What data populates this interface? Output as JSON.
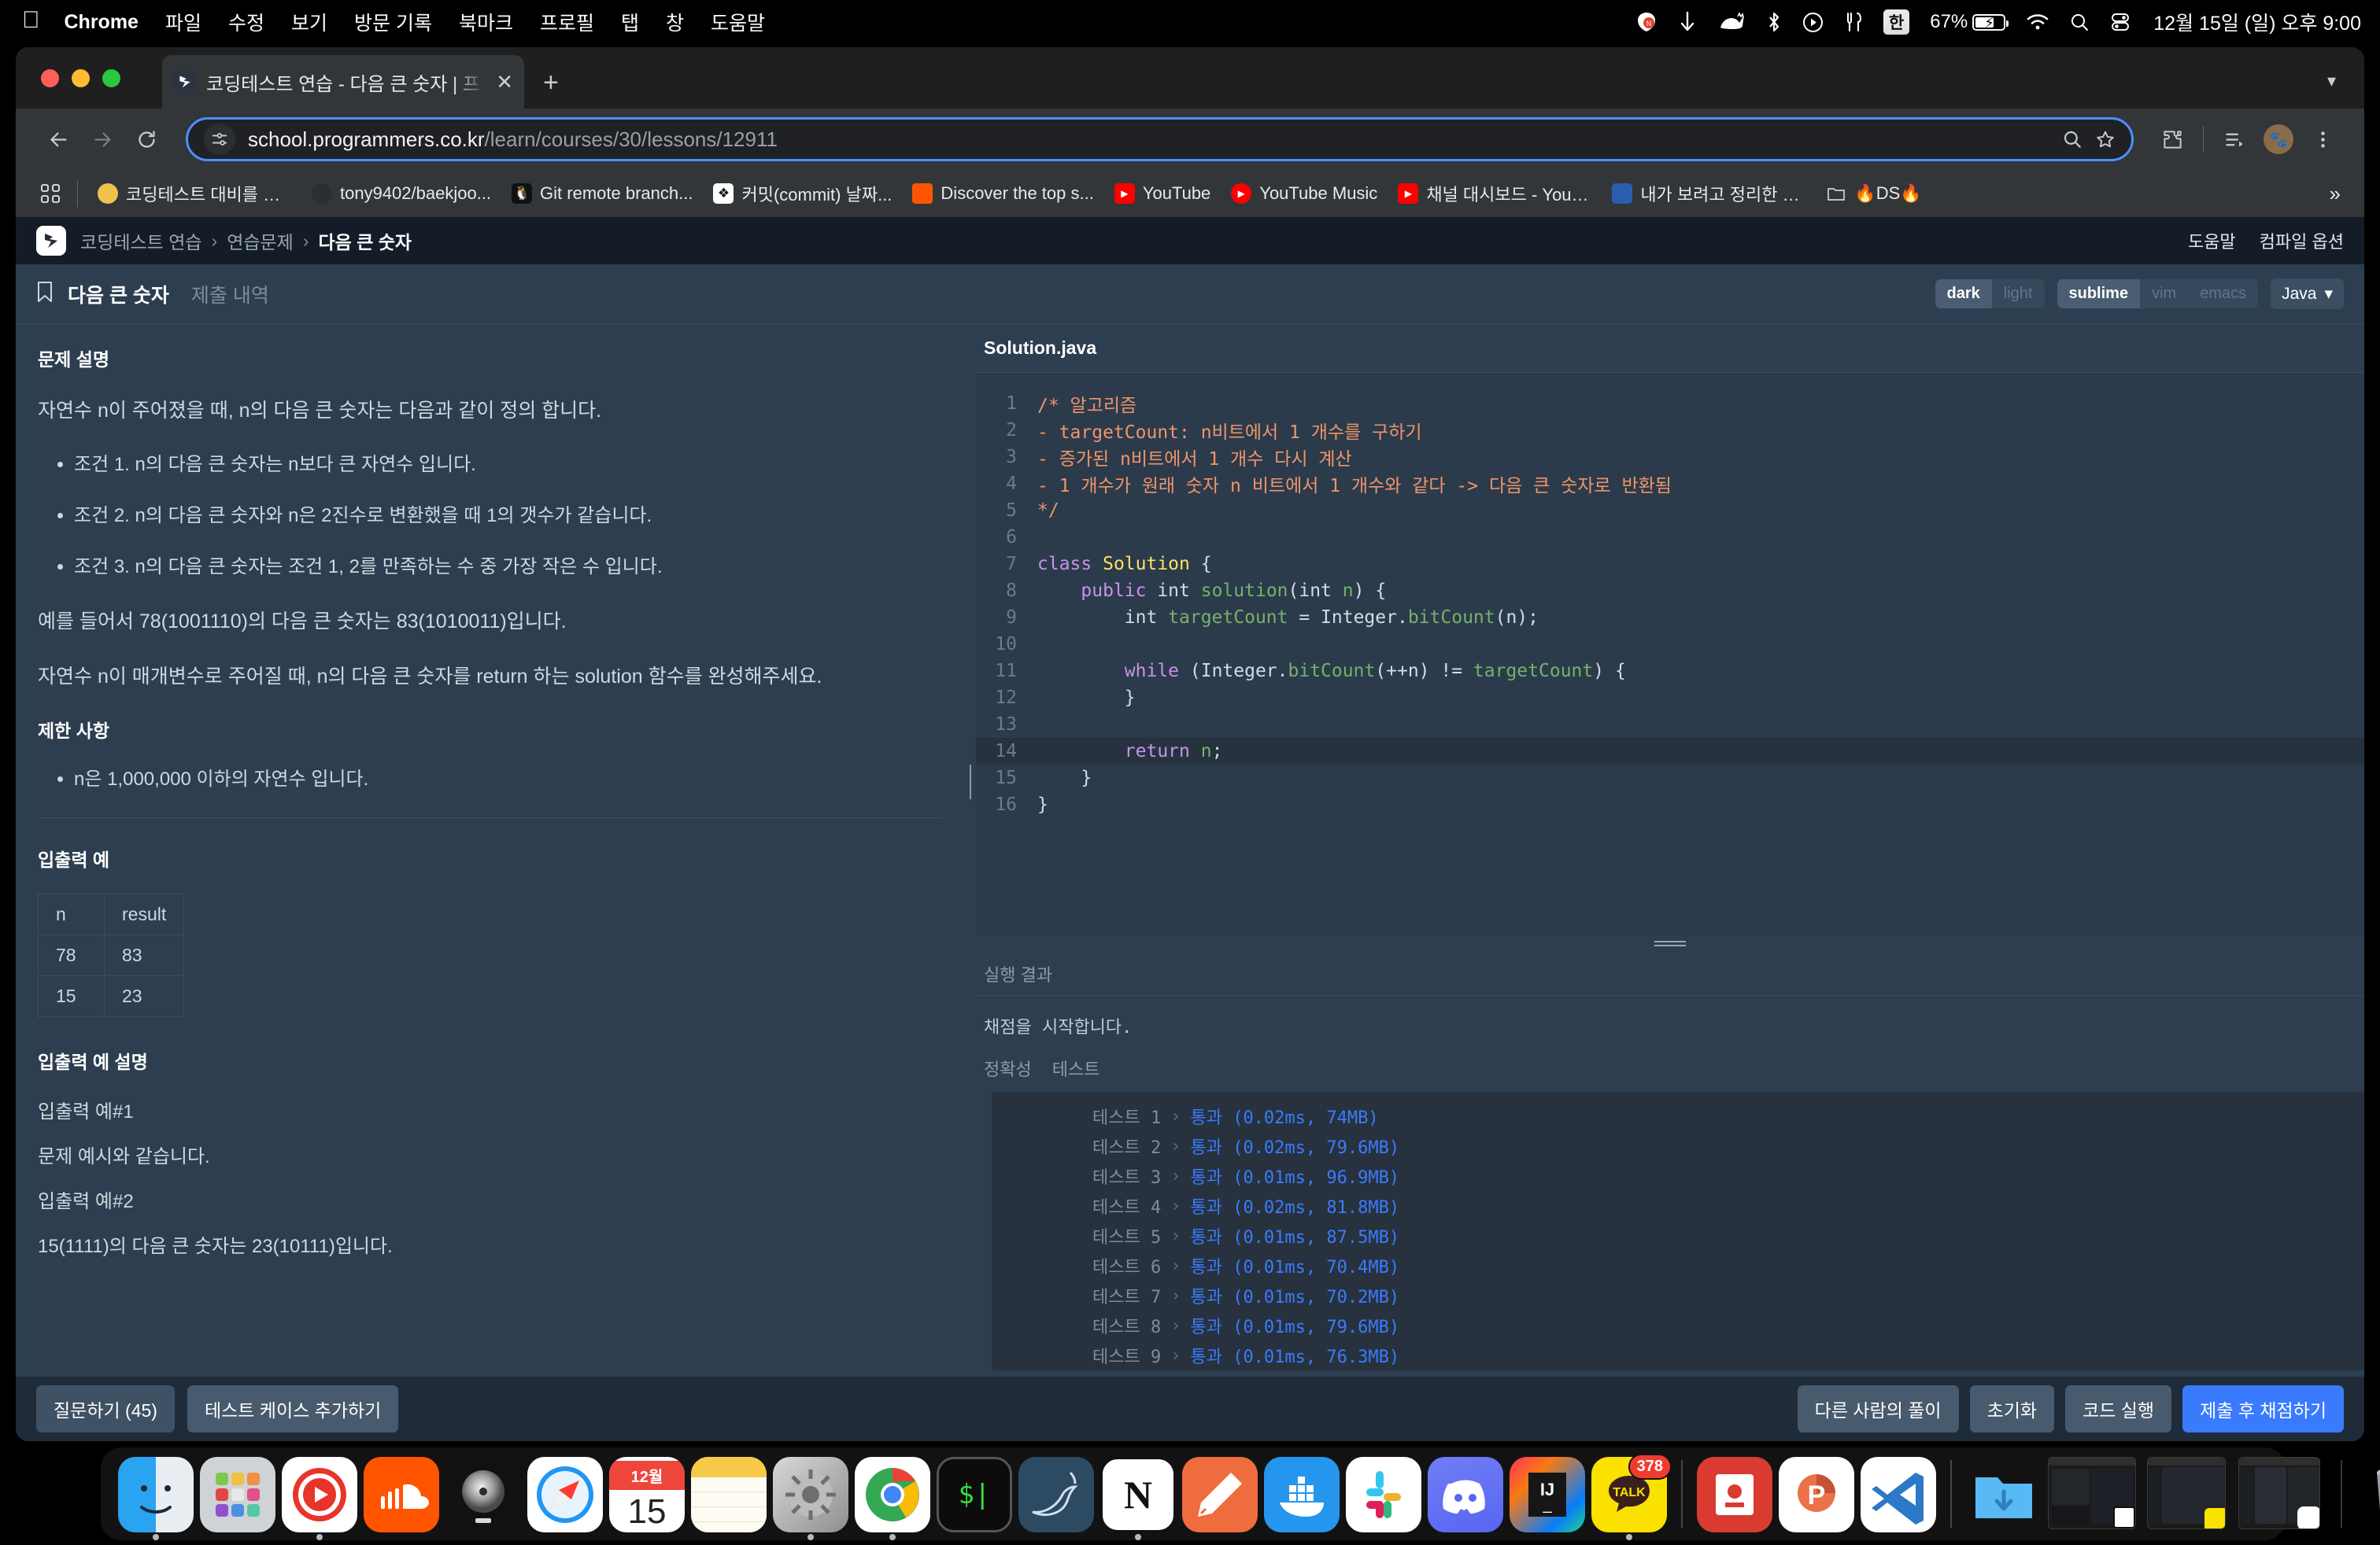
{
  "menubar": {
    "apple": "apple-logo",
    "app": "Chrome",
    "items": [
      "파일",
      "수정",
      "보기",
      "방문 기록",
      "북마크",
      "프로필",
      "탭",
      "창",
      "도움말"
    ],
    "status": {
      "battery_percent": "67%",
      "ime": "한",
      "clock": "12월 15일 (일) 오후 9:00",
      "icons": [
        "notion-icon",
        "download-arrow-icon",
        "cat-icon",
        "bluetooth-icon",
        "play-circle-icon",
        "utensils-icon",
        "ime-badge",
        "battery-icon",
        "wifi-icon",
        "spotlight-search-icon",
        "control-center-icon"
      ]
    }
  },
  "browser": {
    "tab": {
      "title": "코딩테스트 연습 - 다음 큰 숫자 | 프",
      "favicon": "programmers-icon",
      "close": "✕"
    },
    "newtab_label": "+",
    "url_host": "school.programmers.co.kr",
    "url_path": "/learn/courses/30/lessons/12911",
    "bookmarks": [
      {
        "label": "코딩테스트 대비를 위...",
        "icon": "coin-icon"
      },
      {
        "label": "tony9402/baekjoo...",
        "icon": "github-icon"
      },
      {
        "label": "Git remote branch...",
        "icon": "penguin-icon"
      },
      {
        "label": "커밋(commit) 날짜...",
        "icon": "git-icon"
      },
      {
        "label": "Discover the top s...",
        "icon": "soundcloud-icon"
      },
      {
        "label": "YouTube",
        "icon": "youtube-icon"
      },
      {
        "label": "YouTube Music",
        "icon": "youtube-music-icon"
      },
      {
        "label": "채널 대시보드 - YouT...",
        "icon": "youtube-studio-icon"
      },
      {
        "label": "내가 보려고 정리한 정...",
        "icon": "notion-blue-icon"
      },
      {
        "label": "🔥DS🔥",
        "icon": "folder-icon"
      }
    ],
    "overflow": "»"
  },
  "site": {
    "breadcrumb": [
      "코딩테스트 연습",
      "연습문제",
      "다음 큰 숫자"
    ],
    "header_links": [
      "도움말",
      "컴파일 옵션"
    ],
    "tabs": [
      {
        "label": "다음 큰 숫자",
        "active": true
      },
      {
        "label": "제출 내역",
        "active": false
      }
    ],
    "options": {
      "theme": [
        {
          "label": "dark",
          "on": true
        },
        {
          "label": "light",
          "on": false
        }
      ],
      "keymap": [
        {
          "label": "sublime",
          "on": true
        },
        {
          "label": "vim",
          "on": false
        },
        {
          "label": "emacs",
          "on": false
        }
      ],
      "language": "Java"
    }
  },
  "problem": {
    "desc_title": "문제 설명",
    "intro": "자연수 n이 주어졌을 때, n의 다음 큰 숫자는 다음과 같이 정의 합니다.",
    "conditions": [
      "조건 1. n의 다음 큰 숫자는 n보다 큰 자연수 입니다.",
      "조건 2. n의 다음 큰 숫자와 n은 2진수로 변환했을 때 1의 갯수가 같습니다.",
      "조건 3. n의 다음 큰 숫자는 조건 1, 2를 만족하는 수 중 가장 작은 수 입니다."
    ],
    "example_sentence": "예를 들어서 78(1001110)의 다음 큰 숫자는 83(1010011)입니다.",
    "task_sentence": "자연수 n이 매개변수로 주어질 때, n의 다음 큰 숫자를 return 하는 solution 함수를 완성해주세요.",
    "limits_title": "제한 사항",
    "limits": [
      "n은 1,000,000 이하의 자연수 입니다."
    ],
    "io_title": "입출력 예",
    "io_table": {
      "headers": [
        "n",
        "result"
      ],
      "rows": [
        [
          "78",
          "83"
        ],
        [
          "15",
          "23"
        ]
      ]
    },
    "io_expl_title": "입출력 예 설명",
    "io_expl": [
      "입출력 예#1",
      "문제 예시와 같습니다.",
      "입출력 예#2",
      "15(1111)의 다음 큰 숫자는 23(10111)입니다."
    ]
  },
  "editor": {
    "filename": "Solution.java",
    "highlight_line": 14,
    "lines": [
      {
        "n": "1",
        "tokens": [
          {
            "t": "/* 알고리즘",
            "c": "c-com"
          }
        ]
      },
      {
        "n": "2",
        "tokens": [
          {
            "t": "- targetCount: n비트에서 1 개수를 구하기",
            "c": "c-com"
          }
        ]
      },
      {
        "n": "3",
        "tokens": [
          {
            "t": "- 증가된 n비트에서 1 개수 다시 계산",
            "c": "c-com"
          }
        ]
      },
      {
        "n": "4",
        "tokens": [
          {
            "t": "- 1 개수가 원래 숫자 n 비트에서 1 개수와 같다 -> 다음 큰 숫자로 반환됨",
            "c": "c-com"
          }
        ]
      },
      {
        "n": "5",
        "tokens": [
          {
            "t": "*/",
            "c": "c-com"
          }
        ]
      },
      {
        "n": "6",
        "tokens": [
          {
            "t": "",
            "c": "ctext"
          }
        ]
      },
      {
        "n": "7",
        "tokens": [
          {
            "t": "class ",
            "c": "c-kw"
          },
          {
            "t": "Solution",
            "c": "c-cls"
          },
          {
            "t": " {",
            "c": "c-pun"
          }
        ]
      },
      {
        "n": "8",
        "tokens": [
          {
            "t": "    ",
            "c": "ctext"
          },
          {
            "t": "public",
            "c": "c-kw"
          },
          {
            "t": " int ",
            "c": "c-typ"
          },
          {
            "t": "solution",
            "c": "c-fn"
          },
          {
            "t": "(int ",
            "c": "c-pun"
          },
          {
            "t": "n",
            "c": "c-var"
          },
          {
            "t": ") {",
            "c": "c-pun"
          }
        ]
      },
      {
        "n": "9",
        "tokens": [
          {
            "t": "        int ",
            "c": "c-typ"
          },
          {
            "t": "targetCount",
            "c": "c-var"
          },
          {
            "t": " = Integer.",
            "c": "c-pun"
          },
          {
            "t": "bitCount",
            "c": "c-fn"
          },
          {
            "t": "(n);",
            "c": "c-pun"
          }
        ]
      },
      {
        "n": "10",
        "tokens": [
          {
            "t": "",
            "c": "ctext"
          }
        ]
      },
      {
        "n": "11",
        "tokens": [
          {
            "t": "        ",
            "c": "ctext"
          },
          {
            "t": "while",
            "c": "c-kw"
          },
          {
            "t": " (Integer.",
            "c": "c-pun"
          },
          {
            "t": "bitCount",
            "c": "c-fn"
          },
          {
            "t": "(++n) != ",
            "c": "c-pun"
          },
          {
            "t": "targetCount",
            "c": "c-var"
          },
          {
            "t": ") {",
            "c": "c-pun"
          }
        ]
      },
      {
        "n": "12",
        "tokens": [
          {
            "t": "        }",
            "c": "c-pun"
          }
        ]
      },
      {
        "n": "13",
        "tokens": [
          {
            "t": "",
            "c": "ctext"
          }
        ]
      },
      {
        "n": "14",
        "tokens": [
          {
            "t": "        ",
            "c": "ctext"
          },
          {
            "t": "return",
            "c": "c-kw"
          },
          {
            "t": " ",
            "c": "ctext"
          },
          {
            "t": "n",
            "c": "c-var"
          },
          {
            "t": ";",
            "c": "c-pun"
          }
        ]
      },
      {
        "n": "15",
        "tokens": [
          {
            "t": "    }",
            "c": "c-pun"
          }
        ]
      },
      {
        "n": "16",
        "tokens": [
          {
            "t": "}",
            "c": "c-pun"
          }
        ]
      }
    ]
  },
  "result": {
    "title": "실행 결과",
    "status_line": "채점을 시작합니다.",
    "tabs": [
      "정확성",
      "테스트"
    ],
    "tests": [
      {
        "name": "테스트 1",
        "chev": "›",
        "result": "통과 (0.02ms, 74MB)"
      },
      {
        "name": "테스트 2",
        "chev": "›",
        "result": "통과 (0.02ms, 79.6MB)"
      },
      {
        "name": "테스트 3",
        "chev": "›",
        "result": "통과 (0.01ms, 96.9MB)"
      },
      {
        "name": "테스트 4",
        "chev": "›",
        "result": "통과 (0.02ms, 81.8MB)"
      },
      {
        "name": "테스트 5",
        "chev": "›",
        "result": "통과 (0.01ms, 87.5MB)"
      },
      {
        "name": "테스트 6",
        "chev": "›",
        "result": "통과 (0.01ms, 70.4MB)"
      },
      {
        "name": "테스트 7",
        "chev": "›",
        "result": "통과 (0.01ms, 70.2MB)"
      },
      {
        "name": "테스트 8",
        "chev": "›",
        "result": "통과 (0.01ms, 79.6MB)"
      },
      {
        "name": "테스트 9",
        "chev": "›",
        "result": "통과 (0.01ms, 76.3MB)"
      }
    ]
  },
  "footer": {
    "ask": "질문하기 (45)",
    "add_testcase": "테스트 케이스 추가하기",
    "others": "다른 사람의 풀이",
    "reset": "초기화",
    "run": "코드 실행",
    "submit": "제출 후 채점하기",
    "submit_color": "#3a7bfd"
  },
  "dock": {
    "items": [
      {
        "name": "finder",
        "running": true
      },
      {
        "name": "launchpad",
        "running": false
      },
      {
        "name": "youtube-music",
        "running": true
      },
      {
        "name": "soundcloud",
        "running": false
      },
      {
        "name": "logic-pro",
        "running": false
      },
      {
        "name": "safari",
        "running": false
      },
      {
        "name": "calendar",
        "running": false,
        "month": "12월",
        "day": "15"
      },
      {
        "name": "notes",
        "running": false
      },
      {
        "name": "system-settings",
        "running": true
      },
      {
        "name": "chrome",
        "running": true
      },
      {
        "name": "terminal",
        "running": false
      },
      {
        "name": "mysql-workbench",
        "running": false
      },
      {
        "name": "notion",
        "running": true
      },
      {
        "name": "sketch-pen",
        "running": false
      },
      {
        "name": "docker",
        "running": false
      },
      {
        "name": "slack",
        "running": false
      },
      {
        "name": "discord",
        "running": false
      },
      {
        "name": "intellij-idea",
        "running": false
      },
      {
        "name": "kakaotalk",
        "running": true,
        "badge": "378"
      }
    ],
    "minimized": [
      {
        "name": "downloads-folder"
      },
      {
        "name": "notion-window"
      },
      {
        "name": "kakaotalk-window"
      },
      {
        "name": "youtube-music-window"
      }
    ],
    "trash": {
      "name": "trash"
    },
    "right_items": [
      {
        "name": "keynote"
      },
      {
        "name": "powerpoint"
      },
      {
        "name": "vscode"
      }
    ]
  }
}
